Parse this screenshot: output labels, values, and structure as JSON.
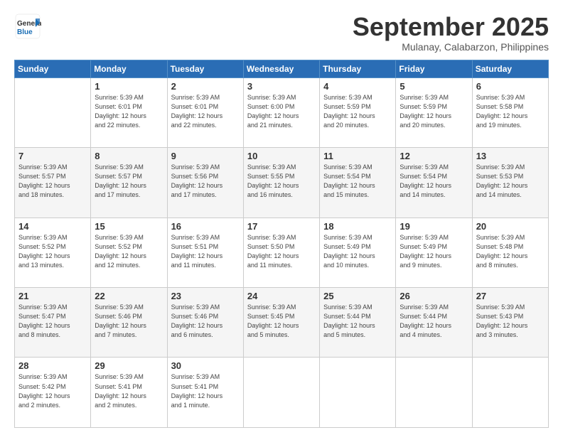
{
  "logo": {
    "line1": "General",
    "line2": "Blue"
  },
  "header": {
    "month": "September 2025",
    "location": "Mulanay, Calabarzon, Philippines"
  },
  "weekdays": [
    "Sunday",
    "Monday",
    "Tuesday",
    "Wednesday",
    "Thursday",
    "Friday",
    "Saturday"
  ],
  "weeks": [
    [
      {
        "num": "",
        "info": ""
      },
      {
        "num": "1",
        "info": "Sunrise: 5:39 AM\nSunset: 6:01 PM\nDaylight: 12 hours\nand 22 minutes."
      },
      {
        "num": "2",
        "info": "Sunrise: 5:39 AM\nSunset: 6:01 PM\nDaylight: 12 hours\nand 22 minutes."
      },
      {
        "num": "3",
        "info": "Sunrise: 5:39 AM\nSunset: 6:00 PM\nDaylight: 12 hours\nand 21 minutes."
      },
      {
        "num": "4",
        "info": "Sunrise: 5:39 AM\nSunset: 5:59 PM\nDaylight: 12 hours\nand 20 minutes."
      },
      {
        "num": "5",
        "info": "Sunrise: 5:39 AM\nSunset: 5:59 PM\nDaylight: 12 hours\nand 20 minutes."
      },
      {
        "num": "6",
        "info": "Sunrise: 5:39 AM\nSunset: 5:58 PM\nDaylight: 12 hours\nand 19 minutes."
      }
    ],
    [
      {
        "num": "7",
        "info": "Sunrise: 5:39 AM\nSunset: 5:57 PM\nDaylight: 12 hours\nand 18 minutes."
      },
      {
        "num": "8",
        "info": "Sunrise: 5:39 AM\nSunset: 5:57 PM\nDaylight: 12 hours\nand 17 minutes."
      },
      {
        "num": "9",
        "info": "Sunrise: 5:39 AM\nSunset: 5:56 PM\nDaylight: 12 hours\nand 17 minutes."
      },
      {
        "num": "10",
        "info": "Sunrise: 5:39 AM\nSunset: 5:55 PM\nDaylight: 12 hours\nand 16 minutes."
      },
      {
        "num": "11",
        "info": "Sunrise: 5:39 AM\nSunset: 5:54 PM\nDaylight: 12 hours\nand 15 minutes."
      },
      {
        "num": "12",
        "info": "Sunrise: 5:39 AM\nSunset: 5:54 PM\nDaylight: 12 hours\nand 14 minutes."
      },
      {
        "num": "13",
        "info": "Sunrise: 5:39 AM\nSunset: 5:53 PM\nDaylight: 12 hours\nand 14 minutes."
      }
    ],
    [
      {
        "num": "14",
        "info": "Sunrise: 5:39 AM\nSunset: 5:52 PM\nDaylight: 12 hours\nand 13 minutes."
      },
      {
        "num": "15",
        "info": "Sunrise: 5:39 AM\nSunset: 5:52 PM\nDaylight: 12 hours\nand 12 minutes."
      },
      {
        "num": "16",
        "info": "Sunrise: 5:39 AM\nSunset: 5:51 PM\nDaylight: 12 hours\nand 11 minutes."
      },
      {
        "num": "17",
        "info": "Sunrise: 5:39 AM\nSunset: 5:50 PM\nDaylight: 12 hours\nand 11 minutes."
      },
      {
        "num": "18",
        "info": "Sunrise: 5:39 AM\nSunset: 5:49 PM\nDaylight: 12 hours\nand 10 minutes."
      },
      {
        "num": "19",
        "info": "Sunrise: 5:39 AM\nSunset: 5:49 PM\nDaylight: 12 hours\nand 9 minutes."
      },
      {
        "num": "20",
        "info": "Sunrise: 5:39 AM\nSunset: 5:48 PM\nDaylight: 12 hours\nand 8 minutes."
      }
    ],
    [
      {
        "num": "21",
        "info": "Sunrise: 5:39 AM\nSunset: 5:47 PM\nDaylight: 12 hours\nand 8 minutes."
      },
      {
        "num": "22",
        "info": "Sunrise: 5:39 AM\nSunset: 5:46 PM\nDaylight: 12 hours\nand 7 minutes."
      },
      {
        "num": "23",
        "info": "Sunrise: 5:39 AM\nSunset: 5:46 PM\nDaylight: 12 hours\nand 6 minutes."
      },
      {
        "num": "24",
        "info": "Sunrise: 5:39 AM\nSunset: 5:45 PM\nDaylight: 12 hours\nand 5 minutes."
      },
      {
        "num": "25",
        "info": "Sunrise: 5:39 AM\nSunset: 5:44 PM\nDaylight: 12 hours\nand 5 minutes."
      },
      {
        "num": "26",
        "info": "Sunrise: 5:39 AM\nSunset: 5:44 PM\nDaylight: 12 hours\nand 4 minutes."
      },
      {
        "num": "27",
        "info": "Sunrise: 5:39 AM\nSunset: 5:43 PM\nDaylight: 12 hours\nand 3 minutes."
      }
    ],
    [
      {
        "num": "28",
        "info": "Sunrise: 5:39 AM\nSunset: 5:42 PM\nDaylight: 12 hours\nand 2 minutes."
      },
      {
        "num": "29",
        "info": "Sunrise: 5:39 AM\nSunset: 5:41 PM\nDaylight: 12 hours\nand 2 minutes."
      },
      {
        "num": "30",
        "info": "Sunrise: 5:39 AM\nSunset: 5:41 PM\nDaylight: 12 hours\nand 1 minute."
      },
      {
        "num": "",
        "info": ""
      },
      {
        "num": "",
        "info": ""
      },
      {
        "num": "",
        "info": ""
      },
      {
        "num": "",
        "info": ""
      }
    ]
  ]
}
